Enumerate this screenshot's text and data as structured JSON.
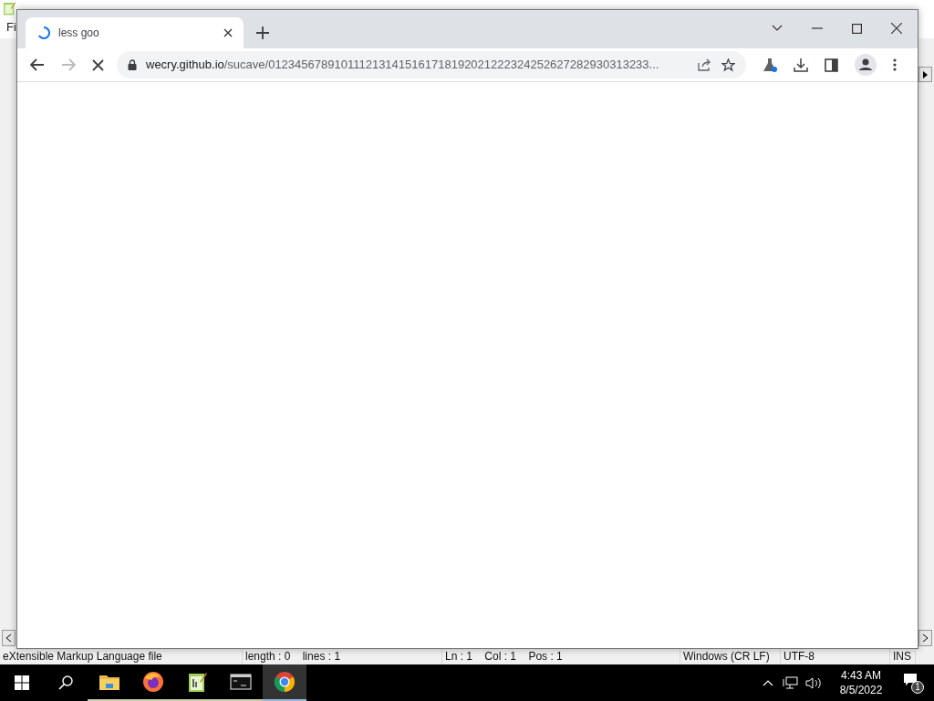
{
  "background_editor": {
    "menu": [
      "Fi"
    ],
    "status_bar": [
      "eXtensible Markup Language file",
      "length : 0    lines : 1",
      "Ln : 1    Col : 1    Pos : 1",
      "Windows (CR LF)",
      "UTF-8",
      "INS"
    ]
  },
  "browser": {
    "tabs": [
      {
        "title": "less goo",
        "loading": true,
        "selected": true
      }
    ],
    "address": {
      "host": "wecry.github.io",
      "path": "/sucave/0123456789101112131415161718192021222324252627282930313233..."
    },
    "loading": true
  },
  "taskbar": {
    "apps": [
      {
        "kind": "folder",
        "active": false
      },
      {
        "kind": "firefox",
        "active": false
      },
      {
        "kind": "notepad",
        "active": false
      },
      {
        "kind": "terminal",
        "active": false
      },
      {
        "kind": "chrome",
        "active": true
      }
    ],
    "time": "4:43 AM",
    "date": "8/5/2022",
    "notifications": "1"
  }
}
